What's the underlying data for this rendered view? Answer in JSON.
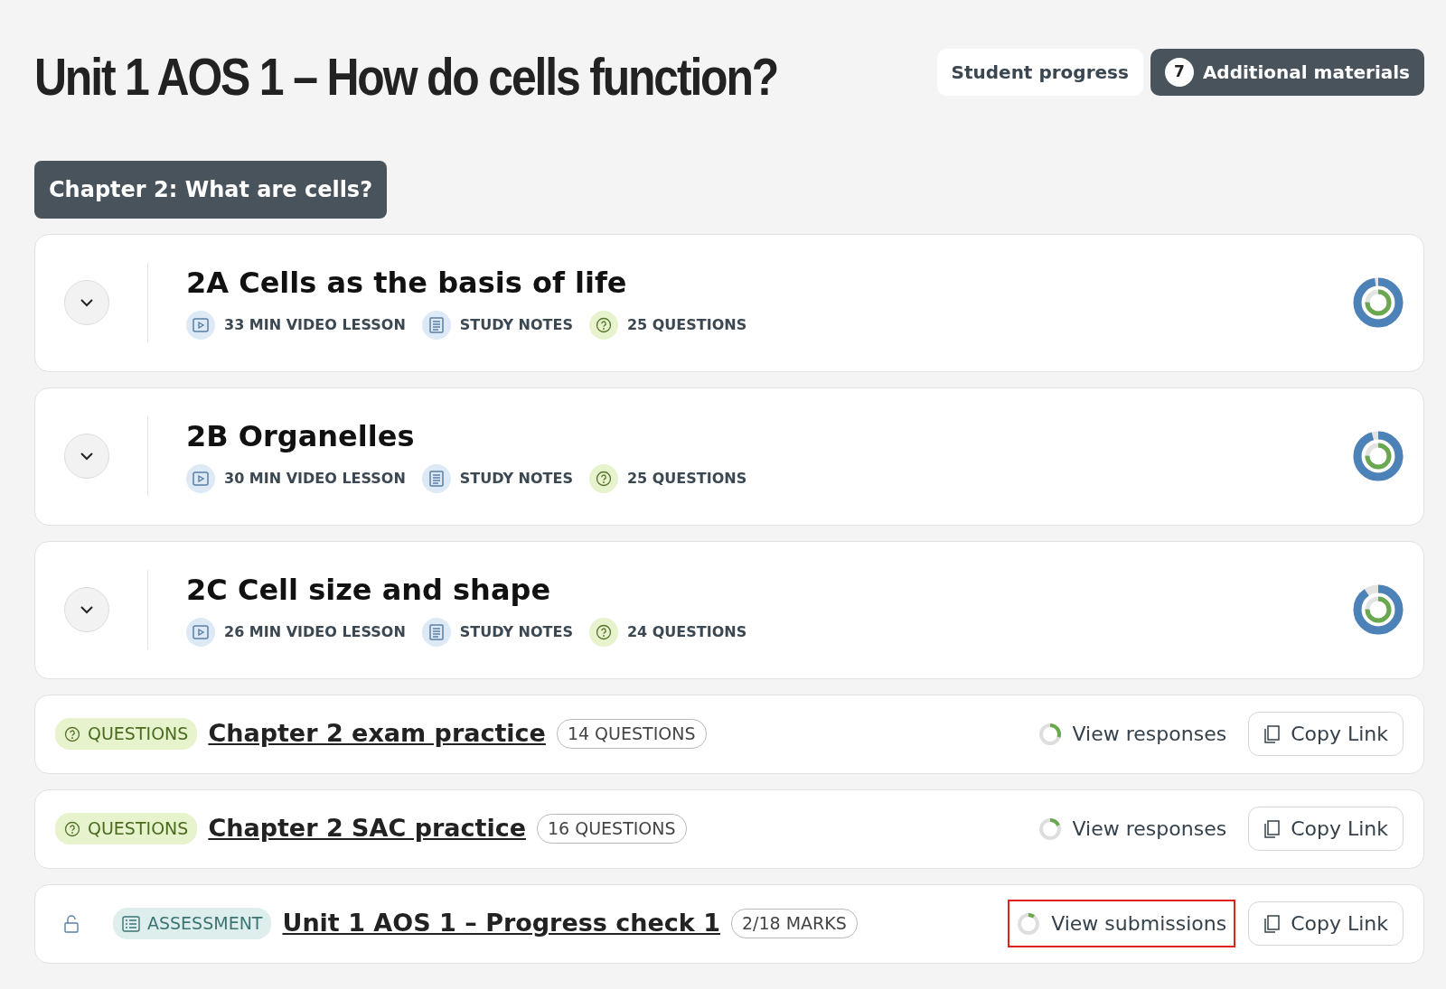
{
  "header": {
    "title": "Unit 1 AOS 1 – How do cells function?",
    "buttons": [
      {
        "kind": "plain",
        "label": "Student progress"
      },
      {
        "kind": "count",
        "count": "7",
        "label": "Additional materials"
      }
    ]
  },
  "chapter": {
    "title": "Chapter 2: What are cells?"
  },
  "lessons": [
    {
      "title": "2A Cells as the basis of life",
      "expanded": false,
      "meta": [
        {
          "kind": "video",
          "text": "33 MIN VIDEO LESSON"
        },
        {
          "kind": "notes",
          "text": "STUDY NOTES"
        },
        {
          "kind": "questions",
          "text": "25 QUESTIONS"
        }
      ],
      "progress": {
        "level": 0.97
      },
      "inner_progress": {
        "level": 0.75
      }
    },
    {
      "title": "2B Organelles",
      "expanded": false,
      "meta": [
        {
          "kind": "video",
          "text": "30 MIN VIDEO LESSON"
        },
        {
          "kind": "notes",
          "text": "STUDY NOTES"
        },
        {
          "kind": "questions",
          "text": "25 QUESTIONS"
        }
      ],
      "progress": {
        "level": 0.95
      },
      "inner_progress": {
        "level": 0.75
      }
    },
    {
      "title": "2C Cell size and shape",
      "expanded": false,
      "meta": [
        {
          "kind": "video",
          "text": "26 MIN VIDEO LESSON"
        },
        {
          "kind": "notes",
          "text": "STUDY NOTES"
        },
        {
          "kind": "questions",
          "text": "24 QUESTIONS"
        }
      ],
      "progress": {
        "level": 0.9
      },
      "inner_progress": {
        "level": 0.75
      }
    }
  ],
  "items": [
    {
      "kind": "questions",
      "locked": false,
      "tag": "QUESTIONS",
      "title": "Chapter 2 exam practice",
      "count": "14 QUESTIONS",
      "action": {
        "label": "View responses",
        "level": 0.3,
        "highlighted": false
      },
      "copy": "Copy Link"
    },
    {
      "kind": "questions",
      "locked": false,
      "tag": "QUESTIONS",
      "title": "Chapter 2 SAC practice",
      "count": "16 QUESTIONS",
      "action": {
        "label": "View responses",
        "level": 0.18,
        "highlighted": false
      },
      "copy": "Copy Link"
    },
    {
      "kind": "assessment",
      "locked": true,
      "tag": "ASSESSMENT",
      "title": "Unit 1 AOS 1 – Progress check 1",
      "count": "2/18 MARKS",
      "action": {
        "label": "View submissions",
        "level": 0.1,
        "highlighted": true
      },
      "copy": "Copy Link"
    }
  ]
}
